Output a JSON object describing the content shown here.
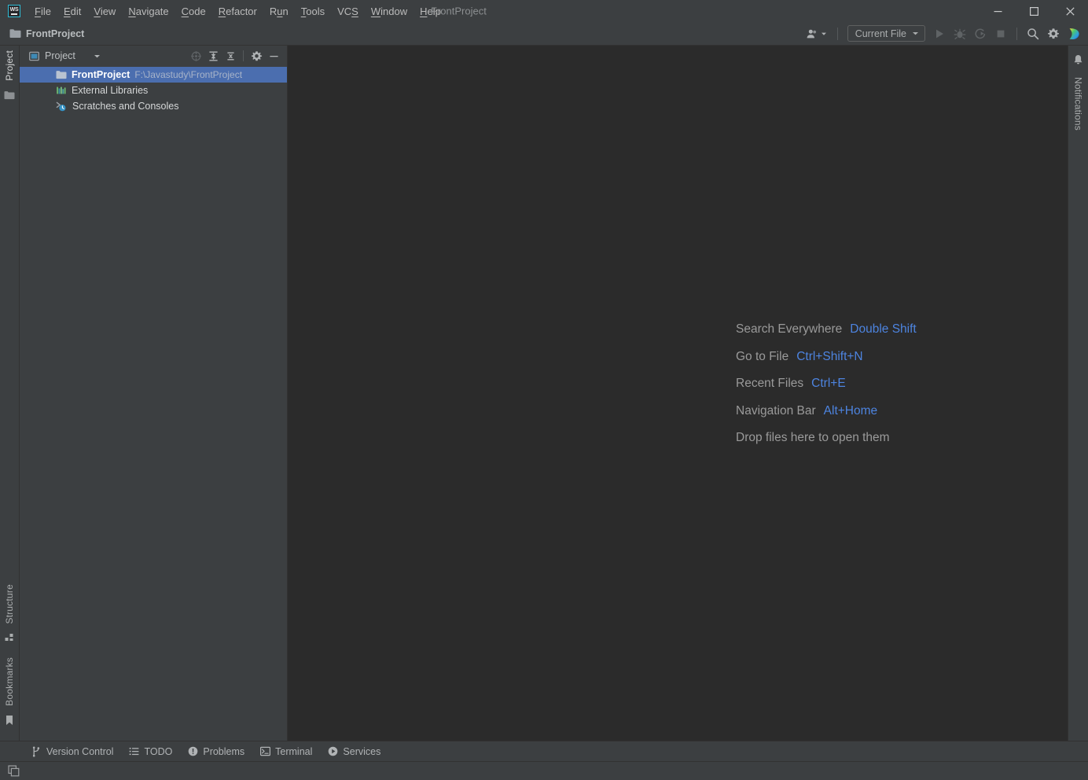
{
  "window": {
    "title": "FrontProject",
    "app_icon": "webstorm-logo-icon",
    "logo_text": "WS",
    "controls": {
      "minimize": "minimize-icon",
      "maximize": "maximize-icon",
      "close": "close-icon"
    }
  },
  "menubar": {
    "items": [
      {
        "label": "File",
        "mnemonic": "F"
      },
      {
        "label": "Edit",
        "mnemonic": "E"
      },
      {
        "label": "View",
        "mnemonic": "V"
      },
      {
        "label": "Navigate",
        "mnemonic": "N"
      },
      {
        "label": "Code",
        "mnemonic": "C"
      },
      {
        "label": "Refactor",
        "mnemonic": "R"
      },
      {
        "label": "Run",
        "mnemonic": "u"
      },
      {
        "label": "Tools",
        "mnemonic": "T"
      },
      {
        "label": "VCS",
        "mnemonic": "S"
      },
      {
        "label": "Window",
        "mnemonic": "W"
      },
      {
        "label": "Help",
        "mnemonic": "H"
      }
    ]
  },
  "toolbar": {
    "breadcrumb": "FrontProject",
    "breadcrumb_icon": "folder-icon",
    "user_icon": "user-account-icon",
    "run_config": "Current File",
    "run_button": "run-icon",
    "debug_button": "debug-icon",
    "coverage_button": "run-with-coverage-icon",
    "stop_button": "stop-icon",
    "search_button": "search-icon",
    "settings_button": "gear-icon",
    "codewithme_button": "code-with-me-icon"
  },
  "left_stripe": {
    "top": [
      {
        "label": "Project",
        "icon": "project-icon",
        "active": true
      }
    ],
    "top_icons": [
      {
        "name": "folder-icon"
      }
    ],
    "bottom": [
      {
        "label": "Structure",
        "icon": "structure-icon"
      },
      {
        "label": "Bookmarks",
        "icon": "bookmarks-icon"
      }
    ]
  },
  "project_panel": {
    "title": "Project",
    "title_icon": "project-view-icon",
    "dropdown_icon": "chevron-down-icon",
    "actions": [
      {
        "name": "select-opened-file-icon"
      },
      {
        "name": "expand-all-icon"
      },
      {
        "name": "collapse-all-icon"
      },
      {
        "name": "gear-icon"
      },
      {
        "name": "hide-icon"
      }
    ],
    "tree": [
      {
        "name": "FrontProject",
        "path": "F:\\Javastudy\\FrontProject",
        "icon": "folder-icon",
        "selected": true
      },
      {
        "name": "External Libraries",
        "path": "",
        "icon": "external-libraries-icon",
        "selected": false
      },
      {
        "name": "Scratches and Consoles",
        "path": "",
        "icon": "scratches-icon",
        "selected": false
      }
    ]
  },
  "editor": {
    "hints": [
      {
        "label": "Search Everywhere",
        "key": "Double Shift"
      },
      {
        "label": "Go to File",
        "key": "Ctrl+Shift+N"
      },
      {
        "label": "Recent Files",
        "key": "Ctrl+E"
      },
      {
        "label": "Navigation Bar",
        "key": "Alt+Home"
      }
    ],
    "drop_hint": "Drop files here to open them"
  },
  "right_stripe": {
    "items": [
      {
        "label": "Notifications",
        "icon": "bell-icon"
      }
    ]
  },
  "statusbar": {
    "items": [
      {
        "label": "Version Control",
        "icon": "branch-icon"
      },
      {
        "label": "TODO",
        "icon": "todo-list-icon"
      },
      {
        "label": "Problems",
        "icon": "problems-icon"
      },
      {
        "label": "Terminal",
        "icon": "terminal-icon"
      },
      {
        "label": "Services",
        "icon": "services-icon"
      }
    ]
  },
  "bottombar": {
    "layout_button": "layout-windows-icon"
  },
  "colors": {
    "chrome": "#3c3f41",
    "editor_bg": "#2b2b2b",
    "selection": "#4b6eaf",
    "accent_link": "#4d84e0",
    "text": "#bbbbbb",
    "logo_border": "#2ebdd6"
  }
}
